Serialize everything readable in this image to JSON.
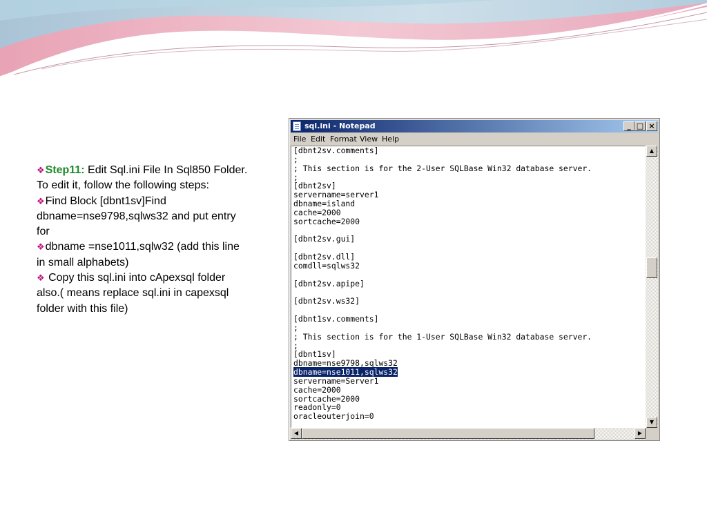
{
  "slide": {
    "bullets": [
      {
        "label": "Step11:",
        "text": " Edit Sql.ini File In Sql850 Folder. To edit it, follow the following steps:"
      },
      {
        "text": "Find Block [dbnt1sv]Find dbname=nse9798,sqlws32 and put entry for"
      },
      {
        "text": "dbname =nse1011,sqlw32   (add this line in small alphabets)"
      },
      {
        "text": " Copy this sql.ini  into  cApexsql folder also.( means replace sql.ini in capexsql folder with this file)"
      }
    ],
    "colors": {
      "accent_diamond": "#c0147f",
      "step_label": "#1d8a2a"
    }
  },
  "notepad": {
    "title": "sql.ini - Notepad",
    "controls": {
      "minimize": "_",
      "maximize": "□",
      "close": "×"
    },
    "menu": [
      "File",
      "Edit",
      "Format",
      "View",
      "Help"
    ],
    "lines": [
      "[dbnt2sv.comments]",
      ";",
      "; This section is for the 2-User SQLBase Win32 database server.",
      ";",
      "[dbnt2sv]",
      "servername=server1",
      "dbname=island",
      "cache=2000",
      "sortcache=2000",
      "",
      "[dbnt2sv.gui]",
      "",
      "[dbnt2sv.dll]",
      "comdll=sqlws32",
      "",
      "[dbnt2sv.apipe]",
      "",
      "[dbnt2sv.ws32]",
      "",
      "[dbnt1sv.comments]",
      ";",
      "; This section is for the 1-User SQLBase Win32 database server.",
      ";",
      "[dbnt1sv]",
      "dbname=nse9798,sqlws32",
      "dbname=nse1011,sqlws32",
      "servername=Server1",
      "cache=2000",
      "sortcache=2000",
      "readonly=0",
      "oracleouterjoin=0"
    ],
    "selected_line_index": 25,
    "vertical_scroll_position": 0.42,
    "colors": {
      "titlebar": "#0a246a",
      "selection": "#0a246a"
    }
  }
}
